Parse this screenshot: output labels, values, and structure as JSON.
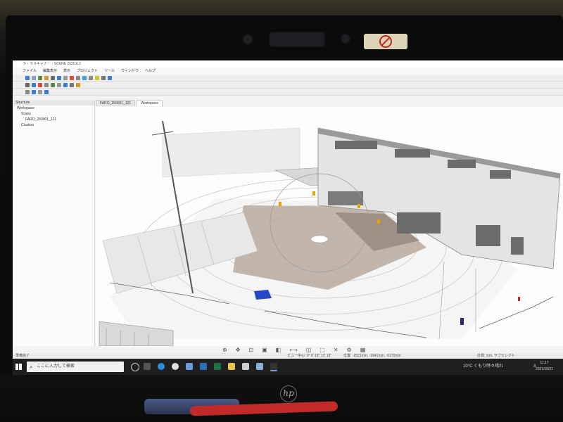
{
  "privacy_cover": {
    "icon": "no-camera-icon"
  },
  "app": {
    "title": "ラ・ラスキャナー・SCENE 2020.0.2",
    "menu": [
      "ファイル",
      "編集表示",
      "表示",
      "プロジェクト",
      "ツール",
      "ウィンドウ",
      "ヘルプ"
    ]
  },
  "panel": {
    "header": "Structure",
    "tree": [
      "Workspace",
      "Scans",
      "FARO_250001_121",
      "Clusters"
    ]
  },
  "tabs": [
    "FARO_250001_121",
    "Workspace"
  ],
  "viewport_tools": [
    "zoom",
    "pan",
    "fit",
    "view",
    "2d",
    "measure",
    "clipping",
    "select",
    "delete",
    "settings",
    "grid"
  ],
  "status": {
    "left": "準備完了",
    "middle": "ビュー中心: 0° 0' 18\" 10' 19\"",
    "coords": "位置: -2521mm, -3541mm, -6170mm",
    "right": "計測: mm, サブセレクト"
  },
  "taskbar": {
    "search_placeholder": "ここに入力して検索",
    "weather": "10°C くもり時々晴れ",
    "time": "11:17",
    "date": "2021/10/21",
    "lang": "A"
  },
  "brand": {
    "logo": "hp"
  },
  "colors": {
    "accent": "#0078d7",
    "floor": "#b8a99d",
    "red": "#c22a2a"
  }
}
